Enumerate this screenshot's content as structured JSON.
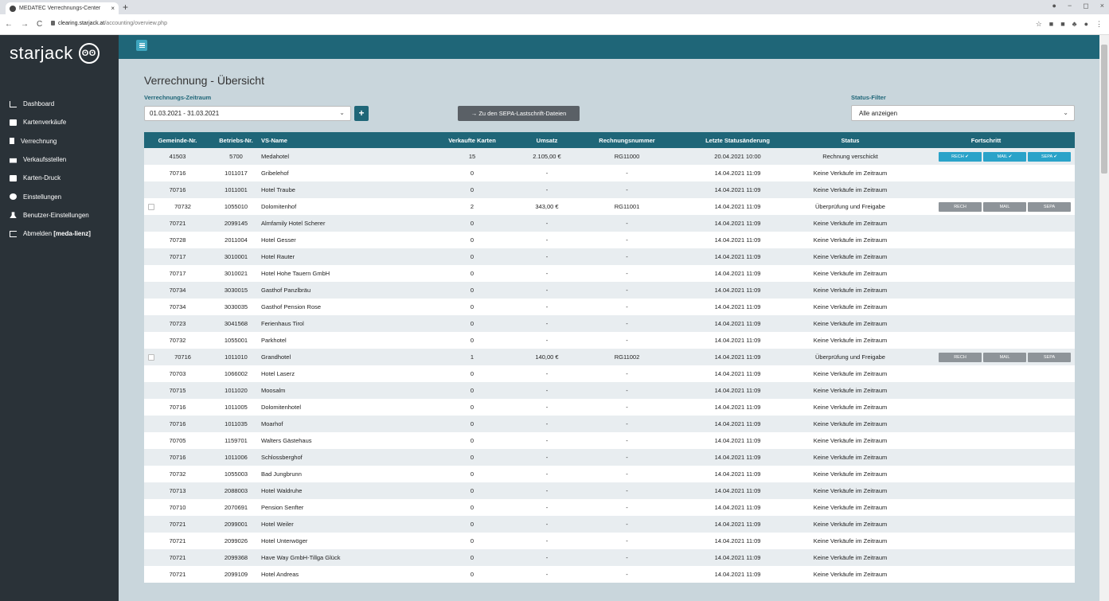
{
  "browser": {
    "tab_title": "MEDATEC Verrechnungs-Center",
    "tab_close": "×",
    "new_tab": "+",
    "url_host": "clearing.starjack.at",
    "url_path": "/accounting/overview.php",
    "nav": [
      "←",
      "→",
      "C"
    ],
    "window_controls": [
      "●",
      "−",
      "◻",
      "×"
    ],
    "ext_icons": [
      "☆",
      "■",
      "■",
      "♣",
      "●",
      "⋮"
    ]
  },
  "sidebar": {
    "logo_text": "starjack",
    "logo_mark": "ʘʘ",
    "items": [
      {
        "label": "Dashboard",
        "icon": "chart-icon"
      },
      {
        "label": "Kartenverkäufe",
        "icon": "card-icon"
      },
      {
        "label": "Verrechnung",
        "icon": "document-icon"
      },
      {
        "label": "Verkaufsstellen",
        "icon": "shop-icon"
      },
      {
        "label": "Karten-Druck",
        "icon": "print-icon"
      },
      {
        "label": "Einstellungen",
        "icon": "gear-icon"
      },
      {
        "label": "Benutzer-Einstellungen",
        "icon": "user-icon"
      },
      {
        "label": "Abmelden ",
        "label_bold": "[meda-lienz]",
        "icon": "logout-icon"
      }
    ]
  },
  "page": {
    "title": "Verrechnung - Übersicht",
    "period_label": "Verrechnungs-Zeitraum",
    "period_value": "01.03.2021 - 31.03.2021",
    "plus_label": "+",
    "sepa_button": "→ Zu den SEPA-Lastschrift-Dateien",
    "status_filter_label": "Status-Filter",
    "status_filter_value": "Alle anzeigen",
    "chevron": "⌄"
  },
  "table": {
    "headers": [
      "Gemeinde-Nr.",
      "Betriebs-Nr.",
      "VS-Name",
      "Verkaufte Karten",
      "Umsatz",
      "Rechnungsnummer",
      "Letzte Statusänderung",
      "Status",
      "Fortschritt"
    ],
    "rows": [
      {
        "chk": false,
        "gem": "41503",
        "betr": "5700",
        "name": "Medahotel",
        "karten": "15",
        "umsatz": "2.105,00 €",
        "rech": "RG11000",
        "datum": "20.04.2021 10:00",
        "status": "Rechnung verschickt",
        "progress": "done",
        "p": [
          "RECH ✔",
          "MAIL ✔",
          "SEPA ✔"
        ]
      },
      {
        "chk": false,
        "gem": "70716",
        "betr": "1011017",
        "name": "Gribelehof",
        "karten": "0",
        "umsatz": "-",
        "rech": "-",
        "datum": "14.04.2021 11:09",
        "status": "Keine Verkäufe im Zeitraum",
        "progress": "none",
        "p": []
      },
      {
        "chk": false,
        "gem": "70716",
        "betr": "1011001",
        "name": "Hotel Traube",
        "karten": "0",
        "umsatz": "-",
        "rech": "-",
        "datum": "14.04.2021 11:09",
        "status": "Keine Verkäufe im Zeitraum",
        "progress": "none",
        "p": []
      },
      {
        "chk": true,
        "gem": "70732",
        "betr": "1055010",
        "name": "Dolomitenhof",
        "karten": "2",
        "umsatz": "343,00 €",
        "rech": "RG11001",
        "datum": "14.04.2021 11:09",
        "status": "Überprüfung und Freigabe",
        "progress": "pending",
        "p": [
          "RECH",
          "MAIL",
          "SEPA"
        ]
      },
      {
        "chk": false,
        "gem": "70721",
        "betr": "2099145",
        "name": "Almfamily Hotel Scherer",
        "karten": "0",
        "umsatz": "-",
        "rech": "-",
        "datum": "14.04.2021 11:09",
        "status": "Keine Verkäufe im Zeitraum",
        "progress": "none",
        "p": []
      },
      {
        "chk": false,
        "gem": "70728",
        "betr": "2011004",
        "name": "Hotel Gesser",
        "karten": "0",
        "umsatz": "-",
        "rech": "-",
        "datum": "14.04.2021 11:09",
        "status": "Keine Verkäufe im Zeitraum",
        "progress": "none",
        "p": []
      },
      {
        "chk": false,
        "gem": "70717",
        "betr": "3010001",
        "name": "Hotel Rauter",
        "karten": "0",
        "umsatz": "-",
        "rech": "-",
        "datum": "14.04.2021 11:09",
        "status": "Keine Verkäufe im Zeitraum",
        "progress": "none",
        "p": []
      },
      {
        "chk": false,
        "gem": "70717",
        "betr": "3010021",
        "name": "Hotel Hohe Tauern GmbH",
        "karten": "0",
        "umsatz": "-",
        "rech": "-",
        "datum": "14.04.2021 11:09",
        "status": "Keine Verkäufe im Zeitraum",
        "progress": "none",
        "p": []
      },
      {
        "chk": false,
        "gem": "70734",
        "betr": "3030015",
        "name": "Gasthof Panzlbräu",
        "karten": "0",
        "umsatz": "-",
        "rech": "-",
        "datum": "14.04.2021 11:09",
        "status": "Keine Verkäufe im Zeitraum",
        "progress": "none",
        "p": []
      },
      {
        "chk": false,
        "gem": "70734",
        "betr": "3030035",
        "name": "Gasthof Pension Rose",
        "karten": "0",
        "umsatz": "-",
        "rech": "-",
        "datum": "14.04.2021 11:09",
        "status": "Keine Verkäufe im Zeitraum",
        "progress": "none",
        "p": []
      },
      {
        "chk": false,
        "gem": "70723",
        "betr": "3041568",
        "name": "Ferienhaus Tirol",
        "karten": "0",
        "umsatz": "-",
        "rech": "-",
        "datum": "14.04.2021 11:09",
        "status": "Keine Verkäufe im Zeitraum",
        "progress": "none",
        "p": []
      },
      {
        "chk": false,
        "gem": "70732",
        "betr": "1055001",
        "name": "Parkhotel",
        "karten": "0",
        "umsatz": "-",
        "rech": "-",
        "datum": "14.04.2021 11:09",
        "status": "Keine Verkäufe im Zeitraum",
        "progress": "none",
        "p": []
      },
      {
        "chk": true,
        "gem": "70716",
        "betr": "1011010",
        "name": "Grandhotel",
        "karten": "1",
        "umsatz": "140,00 €",
        "rech": "RG11002",
        "datum": "14.04.2021 11:09",
        "status": "Überprüfung und Freigabe",
        "progress": "pending",
        "p": [
          "RECH",
          "MAIL",
          "SEPA"
        ]
      },
      {
        "chk": false,
        "gem": "70703",
        "betr": "1066002",
        "name": "Hotel Laserz",
        "karten": "0",
        "umsatz": "-",
        "rech": "-",
        "datum": "14.04.2021 11:09",
        "status": "Keine Verkäufe im Zeitraum",
        "progress": "none",
        "p": []
      },
      {
        "chk": false,
        "gem": "70715",
        "betr": "1011020",
        "name": "Moosalm",
        "karten": "0",
        "umsatz": "-",
        "rech": "-",
        "datum": "14.04.2021 11:09",
        "status": "Keine Verkäufe im Zeitraum",
        "progress": "none",
        "p": []
      },
      {
        "chk": false,
        "gem": "70716",
        "betr": "1011005",
        "name": "Dolomitenhotel",
        "karten": "0",
        "umsatz": "-",
        "rech": "-",
        "datum": "14.04.2021 11:09",
        "status": "Keine Verkäufe im Zeitraum",
        "progress": "none",
        "p": []
      },
      {
        "chk": false,
        "gem": "70716",
        "betr": "1011035",
        "name": "Moarhof",
        "karten": "0",
        "umsatz": "-",
        "rech": "-",
        "datum": "14.04.2021 11:09",
        "status": "Keine Verkäufe im Zeitraum",
        "progress": "none",
        "p": []
      },
      {
        "chk": false,
        "gem": "70705",
        "betr": "1159701",
        "name": "Walters Gästehaus",
        "karten": "0",
        "umsatz": "-",
        "rech": "-",
        "datum": "14.04.2021 11:09",
        "status": "Keine Verkäufe im Zeitraum",
        "progress": "none",
        "p": []
      },
      {
        "chk": false,
        "gem": "70716",
        "betr": "1011006",
        "name": "Schlossberghof",
        "karten": "0",
        "umsatz": "-",
        "rech": "-",
        "datum": "14.04.2021 11:09",
        "status": "Keine Verkäufe im Zeitraum",
        "progress": "none",
        "p": []
      },
      {
        "chk": false,
        "gem": "70732",
        "betr": "1055003",
        "name": "Bad Jungbrunn",
        "karten": "0",
        "umsatz": "-",
        "rech": "-",
        "datum": "14.04.2021 11:09",
        "status": "Keine Verkäufe im Zeitraum",
        "progress": "none",
        "p": []
      },
      {
        "chk": false,
        "gem": "70713",
        "betr": "2088003",
        "name": "Hotel Waldruhe",
        "karten": "0",
        "umsatz": "-",
        "rech": "-",
        "datum": "14.04.2021 11:09",
        "status": "Keine Verkäufe im Zeitraum",
        "progress": "none",
        "p": []
      },
      {
        "chk": false,
        "gem": "70710",
        "betr": "2070691",
        "name": "Pension Senfter",
        "karten": "0",
        "umsatz": "-",
        "rech": "-",
        "datum": "14.04.2021 11:09",
        "status": "Keine Verkäufe im Zeitraum",
        "progress": "none",
        "p": []
      },
      {
        "chk": false,
        "gem": "70721",
        "betr": "2099001",
        "name": "Hotel Weiler",
        "karten": "0",
        "umsatz": "-",
        "rech": "-",
        "datum": "14.04.2021 11:09",
        "status": "Keine Verkäufe im Zeitraum",
        "progress": "none",
        "p": []
      },
      {
        "chk": false,
        "gem": "70721",
        "betr": "2099026",
        "name": "Hotel Unterwöger",
        "karten": "0",
        "umsatz": "-",
        "rech": "-",
        "datum": "14.04.2021 11:09",
        "status": "Keine Verkäufe im Zeitraum",
        "progress": "none",
        "p": []
      },
      {
        "chk": false,
        "gem": "70721",
        "betr": "2099368",
        "name": "Have Way GmbH-Tillga Glück",
        "karten": "0",
        "umsatz": "-",
        "rech": "-",
        "datum": "14.04.2021 11:09",
        "status": "Keine Verkäufe im Zeitraum",
        "progress": "none",
        "p": []
      },
      {
        "chk": false,
        "gem": "70721",
        "betr": "2099109",
        "name": "Hotel Andreas",
        "karten": "0",
        "umsatz": "-",
        "rech": "-",
        "datum": "14.04.2021 11:09",
        "status": "Keine Verkäufe im Zeitraum",
        "progress": "none",
        "p": []
      }
    ]
  },
  "colors": {
    "sidebar_bg": "#2a3238",
    "topbar_bg": "#1f6678",
    "accent": "#2aa3c9",
    "content_bg": "#c9d6dc"
  }
}
